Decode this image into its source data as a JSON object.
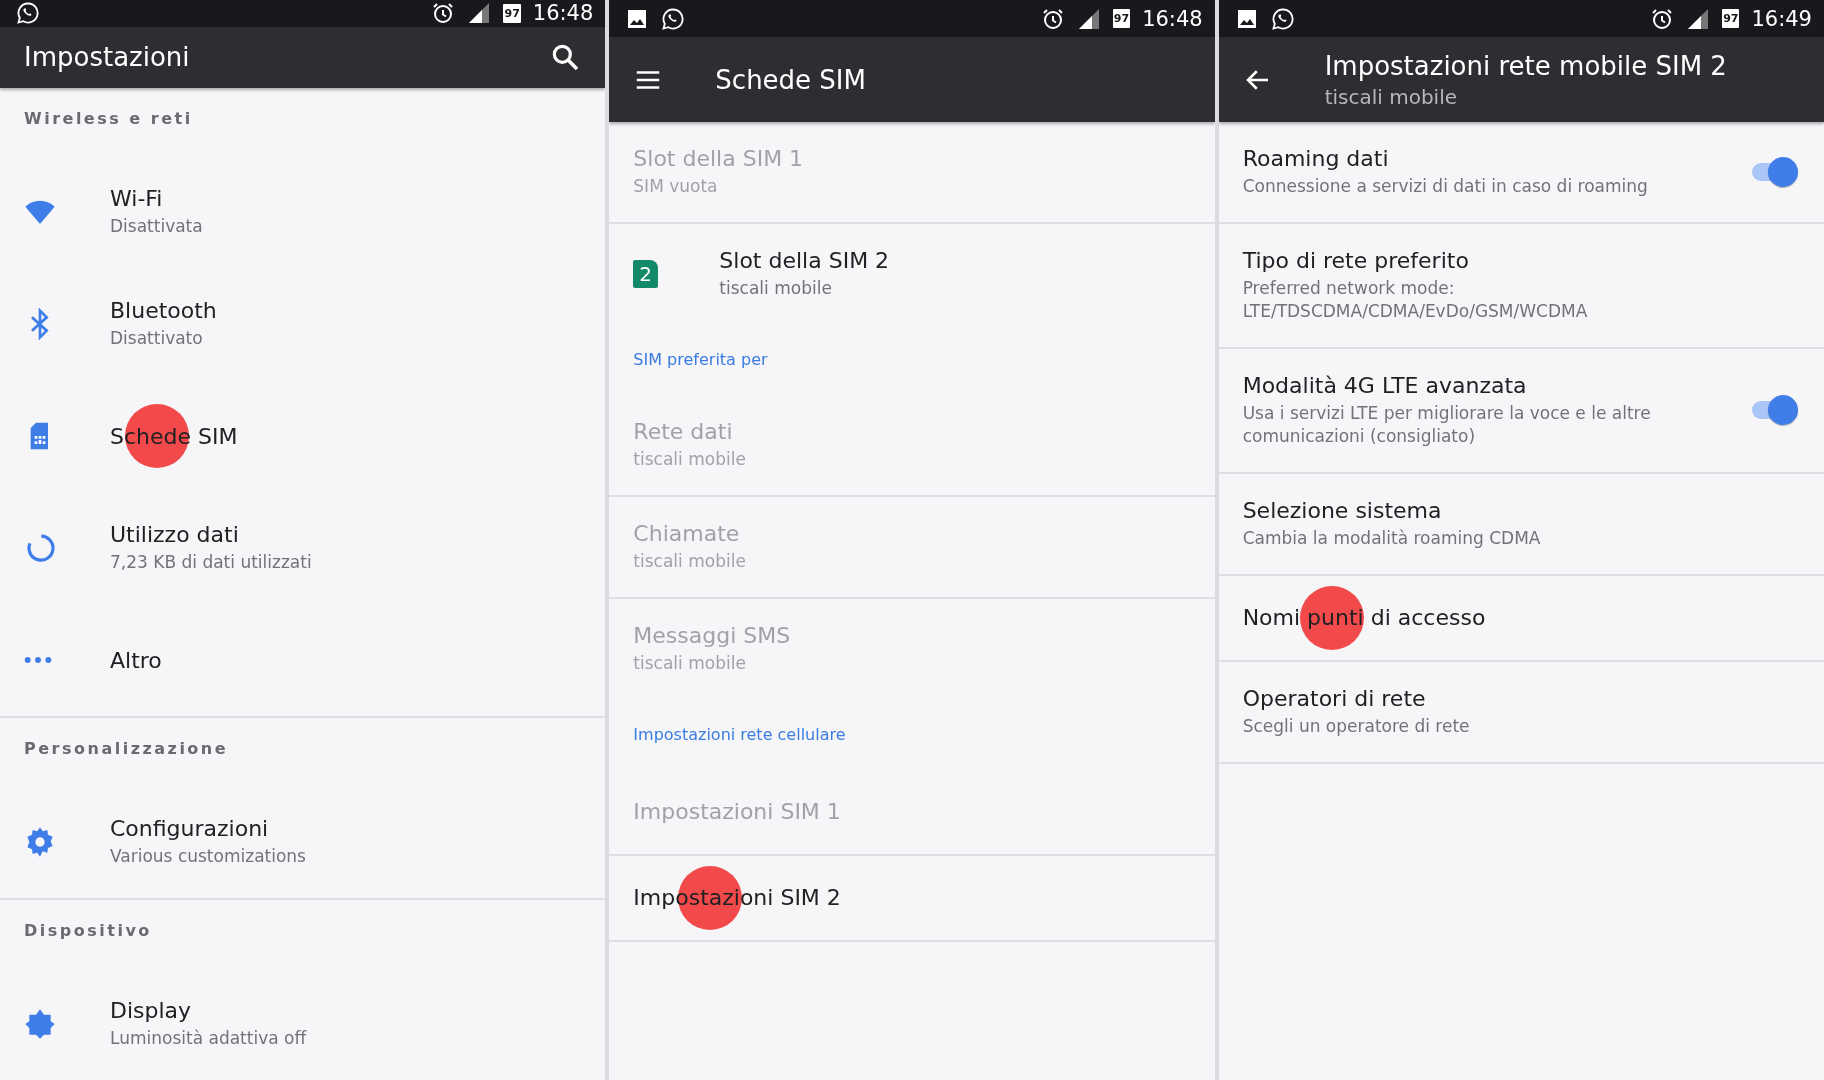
{
  "panels": [
    {
      "status_bar": {
        "notification_icons": [
          {
            "kind": "chat"
          }
        ],
        "battery_text": "97",
        "time": "16:48"
      },
      "toolbar": {
        "title": "Impostazioni"
      },
      "items": [
        {
          "kind": "header",
          "label": "Wireless e reti"
        },
        {
          "kind": "entry",
          "title": "Wi-Fi",
          "subtitle": "Disattivata",
          "disabled": false,
          "touched": false
        },
        {
          "kind": "entry",
          "title": "Bluetooth",
          "subtitle": "Disattivato",
          "disabled": false,
          "touched": false
        },
        {
          "kind": "entry",
          "title": "Schede SIM",
          "disabled": false,
          "touched": true
        },
        {
          "kind": "entry",
          "title": "Utilizzo dati",
          "subtitle": "7,23 KB di dati utilizzati",
          "disabled": false,
          "touched": false
        },
        {
          "kind": "entry",
          "title": "Altro",
          "disabled": false,
          "touched": false
        },
        {
          "kind": "divider"
        },
        {
          "kind": "header",
          "label": "Personalizzazione"
        },
        {
          "kind": "entry",
          "title": "Configurazioni",
          "subtitle": "Various customizations",
          "disabled": false,
          "touched": false
        },
        {
          "kind": "divider"
        },
        {
          "kind": "header",
          "label": "Dispositivo"
        },
        {
          "kind": "entry",
          "title": "Display",
          "subtitle": "Luminosità adattiva off",
          "disabled": false,
          "touched": false
        }
      ]
    },
    {
      "status_bar": {
        "notification_icons": [
          {
            "kind": "picture"
          },
          {
            "kind": "chat"
          }
        ],
        "battery_text": "97",
        "time": "16:48"
      },
      "toolbar": {
        "title": "Schede SIM"
      },
      "items": [
        {
          "kind": "entry",
          "title": "Slot della SIM 1",
          "subtitle": "SIM vuota",
          "disabled": true,
          "touched": false
        },
        {
          "kind": "divider"
        },
        {
          "kind": "entry",
          "badge": "2",
          "title": "Slot della SIM 2",
          "subtitle": "tiscali mobile",
          "disabled": false,
          "touched": false
        },
        {
          "kind": "header",
          "label": "SIM preferita per"
        },
        {
          "kind": "entry",
          "title": "Rete dati",
          "subtitle": "tiscali mobile",
          "disabled": true,
          "touched": false
        },
        {
          "kind": "divider"
        },
        {
          "kind": "entry",
          "title": "Chiamate",
          "subtitle": "tiscali mobile",
          "disabled": true,
          "touched": false
        },
        {
          "kind": "divider"
        },
        {
          "kind": "entry",
          "title": "Messaggi SMS",
          "subtitle": "tiscali mobile",
          "disabled": true,
          "touched": false
        },
        {
          "kind": "header",
          "label": "Impostazioni rete cellulare"
        },
        {
          "kind": "entry",
          "title": "Impostazioni SIM 1",
          "disabled": true,
          "touched": false
        },
        {
          "kind": "divider"
        },
        {
          "kind": "entry",
          "title": "Impostazioni SIM 2",
          "disabled": false,
          "touched": true
        },
        {
          "kind": "divider"
        }
      ]
    },
    {
      "status_bar": {
        "notification_icons": [
          {
            "kind": "picture"
          },
          {
            "kind": "chat"
          }
        ],
        "battery_text": "97",
        "time": "16:49"
      },
      "toolbar": {
        "title": "Impostazioni rete mobile SIM 2",
        "subtitle": "tiscali mobile"
      },
      "items": [
        {
          "kind": "entry",
          "title": "Roaming dati",
          "subtitle": "Connessione a servizi di dati in caso di roaming",
          "disabled": false,
          "touched": false,
          "toggle": {
            "on": true
          }
        },
        {
          "kind": "divider"
        },
        {
          "kind": "entry",
          "title": "Tipo di rete preferito",
          "subtitle": "Preferred network mode: LTE/TDSCDMA/CDMA/EvDo/GSM/WCDMA",
          "disabled": false,
          "touched": false
        },
        {
          "kind": "divider"
        },
        {
          "kind": "entry",
          "title": "Modalità 4G LTE avanzata",
          "subtitle": "Usa i servizi LTE per migliorare la voce e le altre comunicazioni (consigliato)",
          "disabled": false,
          "touched": false,
          "toggle": {
            "on": true
          }
        },
        {
          "kind": "divider"
        },
        {
          "kind": "entry",
          "title": "Selezione sistema",
          "subtitle": "Cambia la modalità roaming CDMA",
          "disabled": false,
          "touched": false
        },
        {
          "kind": "divider"
        },
        {
          "kind": "entry",
          "title": "Nomi punti di accesso",
          "disabled": false,
          "touched": true
        },
        {
          "kind": "divider"
        },
        {
          "kind": "entry",
          "title": "Operatori di rete",
          "subtitle": "Scegli un operatore di rete",
          "disabled": false,
          "touched": false
        },
        {
          "kind": "divider"
        }
      ]
    }
  ]
}
